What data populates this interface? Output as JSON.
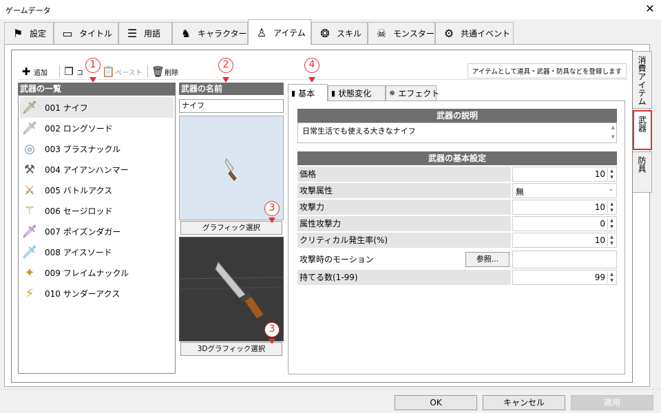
{
  "window": {
    "title": "ゲームデータ",
    "close_glyph": "✕"
  },
  "tabs": [
    {
      "label": "設定",
      "icon": "flag-icon",
      "glyph": "⚑"
    },
    {
      "label": "タイトル",
      "icon": "screen-icon",
      "glyph": "▭"
    },
    {
      "label": "用語",
      "icon": "list-icon",
      "glyph": "☰"
    },
    {
      "label": "キャラクター",
      "icon": "character-icon",
      "glyph": "♞"
    },
    {
      "label": "アイテム",
      "icon": "item-icon",
      "glyph": "♙"
    },
    {
      "label": "スキル",
      "icon": "skill-icon",
      "glyph": "❂"
    },
    {
      "label": "モンスター",
      "icon": "monster-icon",
      "glyph": "☠"
    },
    {
      "label": "共通イベント",
      "icon": "gears-icon",
      "glyph": "⚙"
    }
  ],
  "toolbar": {
    "add": "追加",
    "copy": "コ",
    "paste": "ペースト",
    "delete": "削除",
    "hint": "アイテムとして道具・武器・防具などを登録します"
  },
  "list": {
    "header": "武器の一覧",
    "items": [
      {
        "label": "001 ナイフ",
        "glyph": "🗡",
        "icon": "knife-icon",
        "color": "#8a6d4a"
      },
      {
        "label": "002 ロングソード",
        "glyph": "🗡",
        "icon": "longsword-icon",
        "color": "#777"
      },
      {
        "label": "003 ブラスナックル",
        "glyph": "◎",
        "icon": "knuckle-icon",
        "color": "#6a8fb0"
      },
      {
        "label": "004 アイアンハンマー",
        "glyph": "⚒",
        "icon": "hammer-icon",
        "color": "#555"
      },
      {
        "label": "005 バトルアクス",
        "glyph": "⚔",
        "icon": "axe-icon",
        "color": "#9a7a3a"
      },
      {
        "label": "006 セージロッド",
        "glyph": "⚚",
        "icon": "rod-icon",
        "color": "#c08a30"
      },
      {
        "label": "007 ポイズンダガー",
        "glyph": "🗡",
        "icon": "dagger-icon",
        "color": "#8040a0"
      },
      {
        "label": "008 アイスソード",
        "glyph": "🗡",
        "icon": "icesword-icon",
        "color": "#40a0d0"
      },
      {
        "label": "009 フレイムナックル",
        "glyph": "✦",
        "icon": "flameknuckle-icon",
        "color": "#d09020"
      },
      {
        "label": "010 サンダーアクス",
        "glyph": "⚡",
        "icon": "thunderaxe-icon",
        "color": "#d0a020"
      }
    ]
  },
  "name_panel": {
    "header": "武器の名前",
    "value": "ナイフ",
    "graphic_button": "グラフィック選択",
    "graphic3d_button": "3Dグラフィック選択"
  },
  "subtabs": [
    {
      "label": "基本",
      "glyph": "▮"
    },
    {
      "label": "状態変化",
      "glyph": "▮"
    },
    {
      "label": "エフェクト",
      "glyph": "✵"
    }
  ],
  "description": {
    "header": "武器の説明",
    "text": "日常生活でも使える大きなナイフ"
  },
  "basic": {
    "header": "武器の基本設定",
    "price_label": "価格",
    "price": "10",
    "attribute_label": "攻撃属性",
    "attribute": "無",
    "attack_label": "攻撃力",
    "attack": "10",
    "elem_attack_label": "属性攻撃力",
    "elem_attack": "0",
    "crit_label": "クリティカル発生率(%)",
    "crit": "10",
    "motion_label": "攻撃時のモーション",
    "motion_button": "参照...",
    "max_label": "持てる数(1-99)",
    "max": "99"
  },
  "side_tabs": [
    "消費アイテム",
    "武器",
    "防具"
  ],
  "buttons": {
    "ok": "OK",
    "cancel": "キャンセル",
    "apply": "適用"
  },
  "callouts": {
    "c1": "1",
    "c2": "2",
    "c3": "3",
    "c4": "4"
  },
  "accent": "#e03030"
}
